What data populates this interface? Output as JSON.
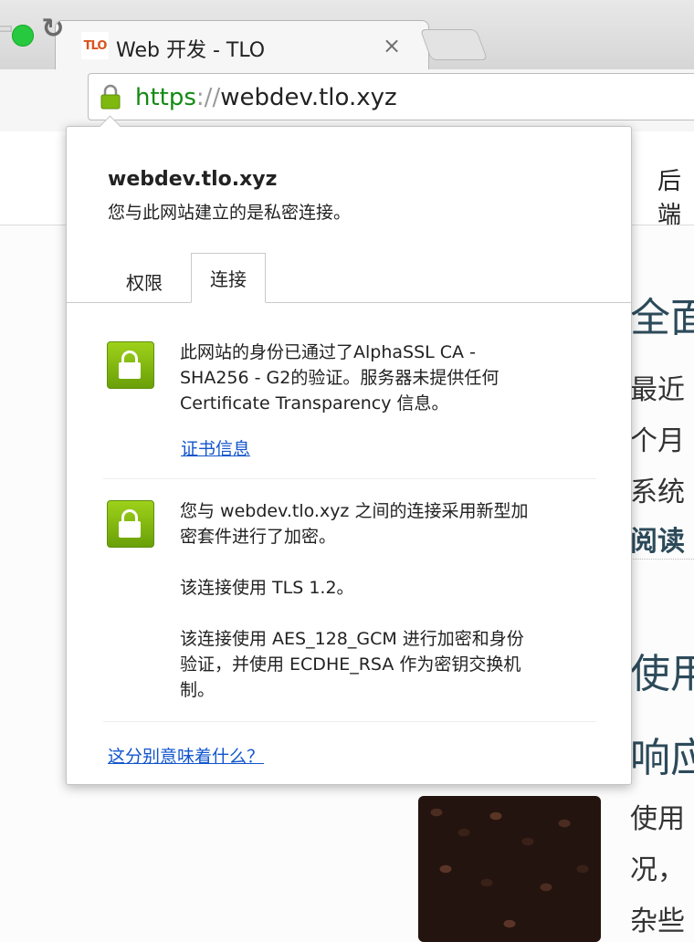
{
  "browser": {
    "tab": {
      "favicon_text": "TLO",
      "title": "Web 开发 - TLO",
      "close_glyph": "×"
    },
    "url": {
      "scheme": "https",
      "separator": "://",
      "host": "webdev.tlo.xyz"
    },
    "colors": {
      "secure_green": "#128a12",
      "link_blue": "#1155cc",
      "lock_green": "#7fb80e"
    }
  },
  "page": {
    "nav_partial": "后端",
    "heading_1": "全面",
    "para_1_line1": "最近",
    "para_1_line2": "个月",
    "para_1_line3": "系统",
    "read_more": "阅读",
    "heading_2_line1": "使用",
    "heading_2_line2": "响应",
    "para_2_line1": "使用",
    "para_2_line2": "况，",
    "para_2_line3": "杂些"
  },
  "popup": {
    "host": "webdev.tlo.xyz",
    "subtitle": "您与此网站建立的是私密连接。",
    "tabs": [
      {
        "label": "权限",
        "active": false
      },
      {
        "label": "连接",
        "active": true
      }
    ],
    "identity": {
      "line1": "此网站的身份已通过了AlphaSSL CA -",
      "line2": "SHA256 - G2的验证。服务器未提供任何",
      "line3": "Certificate Transparency 信息。",
      "link": "证书信息"
    },
    "encryption": {
      "line1": "您与 webdev.tlo.xyz 之间的连接采用新型加",
      "line2": "密套件进行了加密。",
      "tls": "该连接使用 TLS 1.2。",
      "cipher_line1": "该连接使用 AES_128_GCM 进行加密和身份",
      "cipher_line2": "验证，并使用 ECDHE_RSA 作为密钥交换机",
      "cipher_line3": "制。"
    },
    "help_link": "这分别意味着什么？"
  }
}
